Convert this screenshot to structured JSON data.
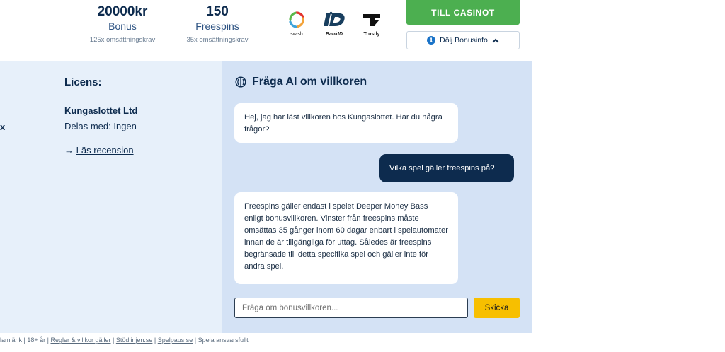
{
  "top": {
    "bonus": {
      "value": "20000kr",
      "label": "Bonus",
      "wagering": "125x omsättningskrav"
    },
    "freespins": {
      "value": "150",
      "label": "Freespins",
      "wagering": "35x omsättningskrav"
    },
    "payments": [
      {
        "name": "swish",
        "icon": "swish-logo"
      },
      {
        "name": "BankID",
        "icon": "bankid-logo"
      },
      {
        "name": "Trustly",
        "icon": "trustly-logo"
      }
    ],
    "cta_label": "TILL CASINOT",
    "toggle_label": "Dölj Bonusinfo",
    "info_glyph": "i",
    "caret_glyph": "^",
    "colors": {
      "cta": "#4caf50",
      "navy": "#0d2b4e",
      "send": "#f7bf00"
    }
  },
  "left": {
    "cut_text": "x",
    "license_title": "Licens:",
    "company": "Kungaslottet Ltd",
    "shared_with": "Delas med: Ingen",
    "review_arrow": "→",
    "review_link": "Läs recension"
  },
  "chat": {
    "title": "Fråga AI om villkoren",
    "messages": [
      {
        "role": "ai",
        "text": "Hej, jag har läst villkoren hos Kungaslottet. Har du några frågor?"
      },
      {
        "role": "user",
        "text": "Vilka spel gäller freespins på?"
      },
      {
        "role": "ai",
        "text": "Freespins gäller endast i spelet Deeper Money Bass enligt bonusvillkoren. Vinster från freespins måste omsättas 35 gånger inom 60 dagar enbart i spelautomater innan de är tillgängliga för uttag. Således är freespins begränsade till detta specifika spel och gäller inte för andra spel."
      }
    ],
    "input_placeholder": "Fråga om bonusvillkoren...",
    "send_label": "Skicka"
  },
  "footer": {
    "prefix": "lamlänk | 18+ år | ",
    "link_terms": "Regler & villkor gäller",
    "sep1": " | ",
    "link_stodlinjen": "Stödlinjen.se",
    "sep2": " | ",
    "link_spelpaus": "Spelpaus.se",
    "suffix": " | Spela ansvarsfullt"
  }
}
